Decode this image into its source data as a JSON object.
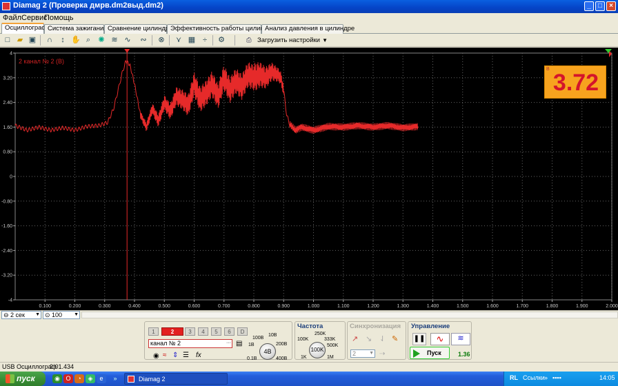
{
  "window": {
    "title": "Diamag 2 (Проверка дмрв.dm2выд.dm2)",
    "buttons": {
      "minimize": "_",
      "maximize": "□",
      "close": "×"
    }
  },
  "menu": [
    "Файл",
    "Сервис",
    "Помощь"
  ],
  "tabs": [
    {
      "label": "Осциллограф",
      "active": true
    },
    {
      "label": "Система зажигания",
      "active": false
    },
    {
      "label": "Сравнение цилиндров",
      "active": false
    },
    {
      "label": "Эффективность работы цилиндров",
      "active": false
    },
    {
      "label": "Анализ давления в цилиндре",
      "active": false
    }
  ],
  "toolbar": {
    "icons": [
      "new-file-icon",
      "open-folder-icon",
      "save-icon",
      "probe-icon",
      "cursor-icon",
      "hand-icon",
      "zoom-icon",
      "filter-icon",
      "wave-compare-icon",
      "wave-multi-icon",
      "stop-icon",
      "markers-icon",
      "table-icon",
      "divide-icon",
      "settings-icon"
    ],
    "load_settings_label": "Загрузить настройки"
  },
  "scope": {
    "channel_label": "2 канал № 2 (В)",
    "readout": {
      "unit": "В",
      "value": "3.72"
    },
    "colors": {
      "trace": "#e62a2a",
      "grid": "#666666",
      "background": "#000000",
      "readout_bg": "#f7a31e",
      "readout_text": "#d4142b"
    }
  },
  "chart_data": {
    "type": "line",
    "title": "",
    "xlabel": "",
    "ylabel": "2 канал № 2 (В)",
    "xlim": [
      0.0,
      2.0
    ],
    "ylim": [
      -4,
      4
    ],
    "x_ticks": [
      "0.100",
      "0.200",
      "0.300",
      "0.400",
      "0.500",
      "0.600",
      "0.700",
      "0.800",
      "0.900",
      "1.000",
      "1.100",
      "1.200",
      "1.300",
      "1.400",
      "1.500",
      "1.600",
      "1.700",
      "1.800",
      "1.900",
      "2.000"
    ],
    "y_ticks": [
      "4",
      "3.20",
      "2.40",
      "1.60",
      "0.80",
      "0",
      "-0.80",
      "-1.60",
      "-2.40",
      "-3.20",
      "-4"
    ],
    "cursor_x": 0.375,
    "grid": true,
    "series": [
      {
        "name": "",
        "x": [
          0.0,
          0.04,
          0.08,
          0.12,
          0.16,
          0.2,
          0.24,
          0.28,
          0.31,
          0.33,
          0.35,
          0.36,
          0.37,
          0.375,
          0.385,
          0.4,
          0.42,
          0.44,
          0.46,
          0.48,
          0.5,
          0.52,
          0.54,
          0.56,
          0.58,
          0.6,
          0.62,
          0.64,
          0.66,
          0.68,
          0.7,
          0.72,
          0.74,
          0.76,
          0.78,
          0.8,
          0.82,
          0.84,
          0.86,
          0.88,
          0.89,
          0.9,
          0.91,
          0.92,
          0.94,
          0.96,
          1.0,
          1.05,
          1.1,
          1.15,
          1.2,
          1.25,
          1.3,
          1.35
        ],
        "y": [
          1.65,
          1.5,
          1.6,
          1.5,
          1.58,
          1.5,
          1.62,
          1.65,
          1.75,
          2.2,
          3.0,
          3.4,
          3.7,
          3.72,
          3.6,
          3.0,
          2.0,
          1.6,
          2.2,
          1.8,
          2.4,
          2.1,
          2.6,
          2.5,
          2.3,
          3.0,
          2.5,
          2.7,
          3.0,
          2.6,
          3.2,
          2.8,
          3.1,
          2.9,
          3.3,
          3.2,
          3.3,
          3.2,
          3.4,
          3.3,
          3.2,
          2.8,
          2.0,
          1.7,
          1.5,
          1.6,
          1.5,
          1.62,
          1.6,
          1.65,
          1.6,
          1.65,
          1.58,
          1.62
        ]
      }
    ]
  },
  "timebase": {
    "time_value": "2 сек",
    "percent_value": "100"
  },
  "panel": {
    "channels": [
      "1",
      "2",
      "3",
      "4",
      "5",
      "6",
      "D"
    ],
    "active_channel": "2",
    "channel_name": "канал № 2",
    "voltage": {
      "knob_value": "4В",
      "labels": [
        "10В",
        "100В",
        "200В",
        "1В",
        "0.1В",
        "400В"
      ]
    },
    "frequency": {
      "title": "Частота",
      "knob_value": "100K",
      "labels": [
        "250K",
        "100K",
        "333K",
        "500K",
        "1K",
        "1M"
      ]
    },
    "sync": {
      "title": "Синхронизация",
      "value": "2"
    },
    "control": {
      "title": "Управление",
      "start_label": "Пуск",
      "value": "1.36"
    }
  },
  "status": {
    "device": "USB Осциллограф",
    "version": "2.01.434"
  },
  "taskbar": {
    "start_label": "пуск",
    "task_label": "Diamag 2",
    "tray_lang": "RL",
    "tray_links": "Ссылки",
    "clock": "14:05"
  }
}
